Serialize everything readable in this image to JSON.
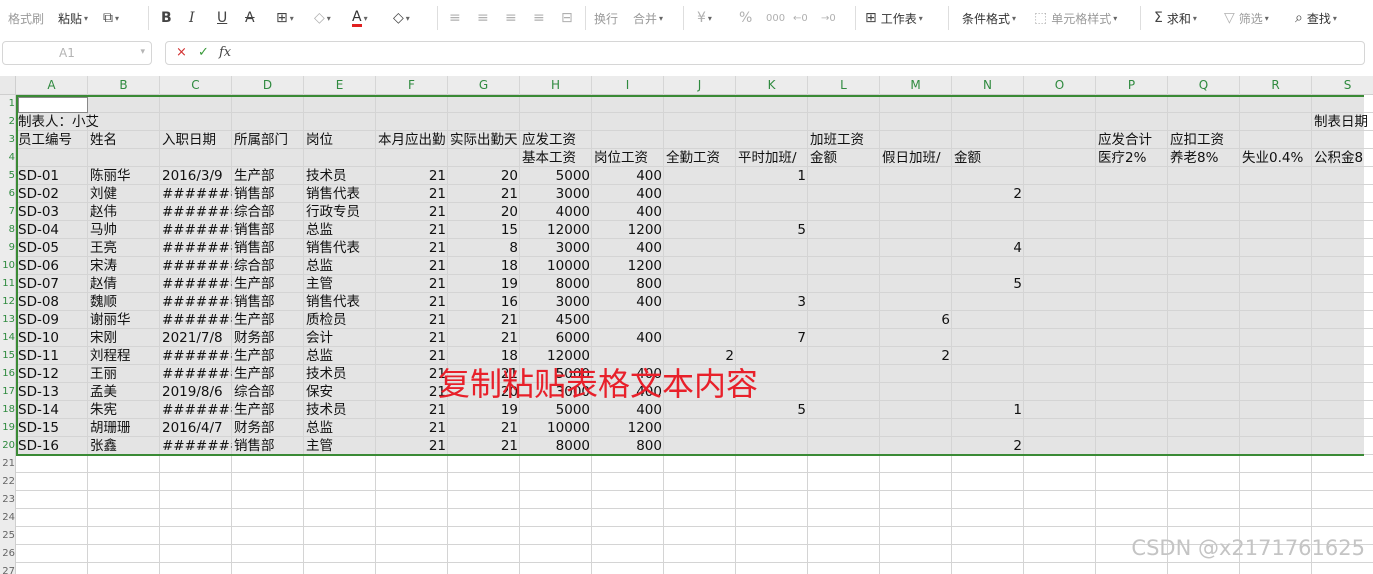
{
  "toolbar": {
    "items": [
      {
        "name": "format-painter-button",
        "label": "格式刷",
        "icon": "",
        "dim": true
      },
      {
        "name": "paste-button",
        "label": "粘贴",
        "icon": "",
        "caret": true
      },
      {
        "name": "copy-button",
        "label": "",
        "icon": "⧉",
        "caret": true
      },
      {
        "name": "bold-button",
        "label": "",
        "icon": "B"
      },
      {
        "name": "italic-button",
        "label": "",
        "icon": "I"
      },
      {
        "name": "underline-button",
        "label": "",
        "icon": "U"
      },
      {
        "name": "strikethrough-button",
        "label": "",
        "icon": "A"
      },
      {
        "name": "border-button",
        "label": "",
        "icon": "⊞",
        "caret": true
      },
      {
        "name": "fill-color-button",
        "label": "",
        "icon": "◇",
        "caret": true,
        "dim": true
      },
      {
        "name": "font-color-button",
        "label": "",
        "icon": "A",
        "caret": true
      },
      {
        "name": "clear-button",
        "label": "",
        "icon": "◇",
        "caret": true
      },
      {
        "name": "align-left-button",
        "label": "",
        "icon": "≡",
        "dim": true
      },
      {
        "name": "align-center-button",
        "label": "",
        "icon": "≡",
        "dim": true
      },
      {
        "name": "align-right-button",
        "label": "",
        "icon": "≡",
        "dim": true
      },
      {
        "name": "justify-button",
        "label": "",
        "icon": "≡",
        "dim": true
      },
      {
        "name": "distribute-button",
        "label": "",
        "icon": "⊟",
        "dim": true
      },
      {
        "name": "wrap-text-button",
        "label": "换行",
        "icon": "",
        "dim": true
      },
      {
        "name": "merge-button",
        "label": "合并",
        "icon": "",
        "caret": true,
        "dim": true
      },
      {
        "name": "currency-button",
        "label": "",
        "icon": "¥",
        "caret": true,
        "dim": true
      },
      {
        "name": "percent-button",
        "label": "",
        "icon": "%",
        "dim": true
      },
      {
        "name": "thousands-button",
        "label": "",
        "icon": "000",
        "dim": true
      },
      {
        "name": "increase-decimal-button",
        "label": "",
        "icon": "←0",
        "dim": true
      },
      {
        "name": "decrease-decimal-button",
        "label": "",
        "icon": "→0",
        "dim": true
      },
      {
        "name": "worksheet-button",
        "label": "工作表",
        "icon": "⊞",
        "caret": true
      },
      {
        "name": "conditional-format-button",
        "label": "条件格式",
        "icon": "",
        "caret": true
      },
      {
        "name": "cell-style-button",
        "label": "单元格样式",
        "icon": "⬚",
        "caret": true,
        "dim": true
      },
      {
        "name": "sum-button",
        "label": "求和",
        "icon": "Σ",
        "caret": true
      },
      {
        "name": "filter-button",
        "label": "筛选",
        "icon": "▽",
        "caret": true,
        "dim": true
      },
      {
        "name": "find-button",
        "label": "查找",
        "icon": "⌕",
        "caret": true
      }
    ]
  },
  "formula_bar": {
    "cell_ref": "A1",
    "cancel_icon": "×",
    "confirm_icon": "✓",
    "fx_icon": "fx"
  },
  "columns": [
    "A",
    "B",
    "C",
    "D",
    "E",
    "F",
    "G",
    "H",
    "I",
    "J",
    "K",
    "L",
    "M",
    "N",
    "O",
    "P",
    "Q",
    "R",
    "S"
  ],
  "rows": [
    "1",
    "2",
    "3",
    "4",
    "5",
    "6",
    "7",
    "8",
    "9",
    "10",
    "11",
    "12",
    "13",
    "14",
    "15",
    "16",
    "17",
    "18",
    "19",
    "20",
    "21",
    "22",
    "23",
    "24",
    "25",
    "26",
    "27"
  ],
  "sheet": {
    "r2": {
      "A": "制表人：小艾",
      "S": "制表日期"
    },
    "r3": {
      "A": "员工编号",
      "B": "姓名",
      "C": "入职日期",
      "D": "所属部门",
      "E": "岗位",
      "F": "本月应出勤",
      "G": "实际出勤天",
      "H": "应发工资",
      "L": "加班工资",
      "P": "应发合计",
      "Q": "应扣工资"
    },
    "r4": {
      "H": "基本工资",
      "I": "岗位工资",
      "J": "全勤工资",
      "K": "平时加班/",
      "L": "金额",
      "M": "假日加班/",
      "N": "金额",
      "P": "医疗2%",
      "Q": "养老8%",
      "R": "失业0.4%",
      "S": "公积金8"
    },
    "records": [
      [
        "SD-01",
        "陈丽华",
        "2016/3/9",
        "生产部",
        "技术员",
        "21",
        "20",
        "5000",
        "400",
        "",
        "1",
        "",
        "",
        ""
      ],
      [
        "SD-02",
        "刘健",
        "########",
        "销售部",
        "销售代表",
        "21",
        "21",
        "3000",
        "400",
        "",
        "",
        "",
        "",
        "2"
      ],
      [
        "SD-03",
        "赵伟",
        "########",
        "综合部",
        "行政专员",
        "21",
        "20",
        "4000",
        "400",
        "",
        "",
        "",
        "",
        ""
      ],
      [
        "SD-04",
        "马帅",
        "########",
        "销售部",
        "总监",
        "21",
        "15",
        "12000",
        "1200",
        "",
        "5",
        "",
        "",
        ""
      ],
      [
        "SD-05",
        "王亮",
        "########",
        "销售部",
        "销售代表",
        "21",
        "8",
        "3000",
        "400",
        "",
        "",
        "",
        "",
        "4"
      ],
      [
        "SD-06",
        "宋涛",
        "########",
        "综合部",
        "总监",
        "21",
        "18",
        "10000",
        "1200",
        "",
        "",
        "",
        "",
        ""
      ],
      [
        "SD-07",
        "赵倩",
        "########",
        "生产部",
        "主管",
        "21",
        "19",
        "8000",
        "800",
        "",
        "",
        "",
        "",
        "5"
      ],
      [
        "SD-08",
        "魏顺",
        "########",
        "销售部",
        "销售代表",
        "21",
        "16",
        "3000",
        "400",
        "",
        "3",
        "",
        "",
        ""
      ],
      [
        "SD-09",
        "谢丽华",
        "########",
        "生产部",
        "质检员",
        "21",
        "21",
        "4500",
        "",
        "",
        "",
        "",
        "6",
        ""
      ],
      [
        "SD-10",
        "宋刚",
        "2021/7/8",
        "财务部",
        "会计",
        "21",
        "21",
        "6000",
        "400",
        "",
        "7",
        "",
        "",
        ""
      ],
      [
        "SD-11",
        "刘程程",
        "########",
        "生产部",
        "总监",
        "21",
        "18",
        "12000",
        "",
        "2",
        "",
        "",
        "2",
        ""
      ],
      [
        "SD-12",
        "王丽",
        "########",
        "生产部",
        "技术员",
        "21",
        "21",
        "5000",
        "400",
        "",
        "",
        "",
        "",
        ""
      ],
      [
        "SD-13",
        "孟美",
        "2019/8/6",
        "综合部",
        "保安",
        "21",
        "20",
        "3000",
        "400",
        "",
        "",
        "",
        "",
        ""
      ],
      [
        "SD-14",
        "朱宪",
        "########",
        "生产部",
        "技术员",
        "21",
        "19",
        "5000",
        "400",
        "",
        "5",
        "",
        "",
        "1"
      ],
      [
        "SD-15",
        "胡珊珊",
        "2016/4/7",
        "财务部",
        "总监",
        "21",
        "21",
        "10000",
        "1200",
        "",
        "",
        "",
        "",
        ""
      ],
      [
        "SD-16",
        "张鑫",
        "########",
        "销售部",
        "主管",
        "21",
        "21",
        "8000",
        "800",
        "",
        "",
        "",
        "",
        "2"
      ]
    ]
  },
  "overlay_text": "复制粘贴表格文本内容",
  "watermark": "CSDN @x2171761625"
}
